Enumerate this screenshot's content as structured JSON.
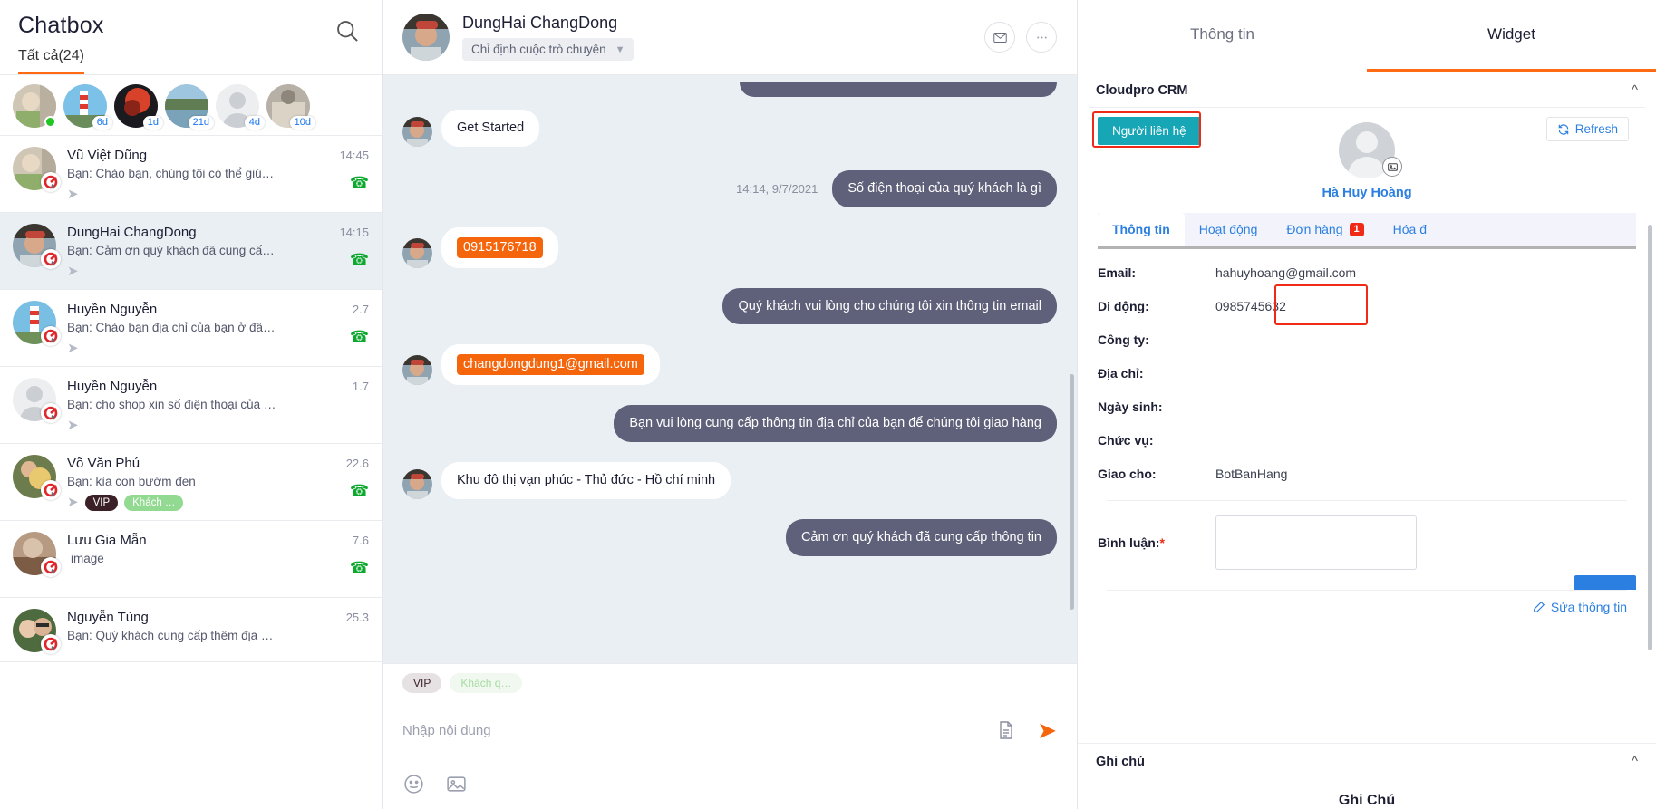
{
  "sidebar": {
    "title": "Chatbox",
    "search_icon": "search-icon",
    "tab_all": "Tất cả(24)",
    "stories": [
      {
        "badge": "",
        "online": true
      },
      {
        "badge": "6d",
        "online": false
      },
      {
        "badge": "1d",
        "online": false
      },
      {
        "badge": "21d",
        "online": false
      },
      {
        "badge": "4d",
        "online": false
      },
      {
        "badge": "10d",
        "online": false
      }
    ],
    "conversations": [
      {
        "name": "Vũ Việt Dũng",
        "preview": "Bạn: Chào bạn, chúng tôi có thể giúp gì ch…",
        "time": "14:45",
        "phone": true,
        "reply": true,
        "tags": []
      },
      {
        "name": "DungHai ChangDong",
        "preview": "Bạn: Cảm ơn quý khách đã cung cấp thông…",
        "time": "14:15",
        "phone": true,
        "reply": true,
        "tags": [],
        "selected": true
      },
      {
        "name": "Huyền Nguyễn",
        "preview": "Bạn: Chào bạn địa chỉ của bạn ở đâu ạ?",
        "time": "2.7",
        "phone": true,
        "reply": true,
        "tags": []
      },
      {
        "name": "Huyền Nguyễn",
        "preview": "Bạn: cho shop xin số điện thoại của bạn",
        "time": "1.7",
        "phone": false,
        "reply": true,
        "tags": []
      },
      {
        "name": "Võ Văn Phú",
        "preview": "Bạn: kìa con bướm đen",
        "time": "22.6",
        "phone": true,
        "reply": true,
        "tags": [
          "VIP",
          "Khách …"
        ]
      },
      {
        "name": "Lưu Gia Mẫn",
        "preview": "image",
        "time": "7.6",
        "phone": true,
        "reply": false,
        "tags": []
      },
      {
        "name": "Nguyễn Tùng",
        "preview": "Bạn: Quý khách cung cấp thêm địa chỉ liên …",
        "time": "25.3",
        "phone": false,
        "reply": false,
        "tags": []
      }
    ]
  },
  "chat": {
    "contact_name": "DungHai ChangDong",
    "assign_label": "Chỉ định cuộc trò chuyện",
    "assign_chevron": "chevron-down-icon",
    "mail_icon": "mail-icon",
    "more_icon": "ellipsis-icon",
    "messages": [
      {
        "dir": "out",
        "text": "",
        "partial": true
      },
      {
        "dir": "in",
        "text": "Get Started"
      },
      {
        "dir": "out",
        "text": "Số điện thoại của quý khách là gì",
        "time": "14:14, 9/7/2021"
      },
      {
        "dir": "in",
        "text": "0915176718",
        "highlight": true
      },
      {
        "dir": "out",
        "text": "Quý khách vui lòng cho chúng tôi xin thông tin email"
      },
      {
        "dir": "in",
        "text": "changdongdung1@gmail.com",
        "highlight": true
      },
      {
        "dir": "out",
        "text": "Bạn vui lòng cung cấp thông tin địa chỉ của bạn để chúng tôi giao hàng"
      },
      {
        "dir": "in",
        "text": "Khu đô thị vạn phúc - Thủ đức - Hồ chí minh"
      },
      {
        "dir": "out",
        "text": "Cảm ơn quý khách đã cung cấp thông tin"
      }
    ],
    "tags": [
      "VIP",
      "Khách q…"
    ],
    "composer_placeholder": "Nhập nội dung",
    "composer_value": "",
    "template_icon": "document-icon",
    "send_icon": "send-icon",
    "emoji_icon": "emoji-icon",
    "image_icon": "image-icon"
  },
  "panel": {
    "tabs": [
      {
        "label": "Thông tin",
        "active": false
      },
      {
        "label": "Widget",
        "active": true
      }
    ],
    "crm": {
      "section_title": "Cloudpro CRM",
      "collapse_icon": "chevron-up-icon",
      "contact_button": "Người liên hệ",
      "refresh_label": "Refresh",
      "refresh_icon": "refresh-icon",
      "camera_icon": "image-upload-icon",
      "contact_name": "Hà Huy Hoàng",
      "tabs": [
        {
          "label": "Thông tin",
          "active": true,
          "count": ""
        },
        {
          "label": "Hoạt động",
          "active": false,
          "count": ""
        },
        {
          "label": "Đơn hàng",
          "active": false,
          "count": "1"
        },
        {
          "label": "Hóa đ",
          "active": false,
          "count": ""
        }
      ],
      "fields": [
        {
          "label": "Email:",
          "value": "hahuyhoang@gmail.com"
        },
        {
          "label": "Di động:",
          "value": "0985745632"
        },
        {
          "label": "Công ty:",
          "value": ""
        },
        {
          "label": "Địa chỉ:",
          "value": ""
        },
        {
          "label": "Ngày sinh:",
          "value": ""
        },
        {
          "label": "Chức vụ:",
          "value": ""
        },
        {
          "label": "Giao cho:",
          "value": "BotBanHang"
        }
      ],
      "comment_label": "Bình luận:",
      "comment_required": "*",
      "comment_value": "",
      "edit_link": "Sửa thông tin",
      "edit_icon": "pencil-icon"
    },
    "note": {
      "section_title": "Ghi chú",
      "collapse_icon": "chevron-up-icon",
      "body_title": "Ghi Chú"
    }
  },
  "colors": {
    "accent_orange": "#ff6a13",
    "out_bubble": "#5f6079",
    "highlight": "#f4650c",
    "teal": "#16a6b6",
    "red_outline": "#ef2b18",
    "link_blue": "#2b7fe0"
  }
}
